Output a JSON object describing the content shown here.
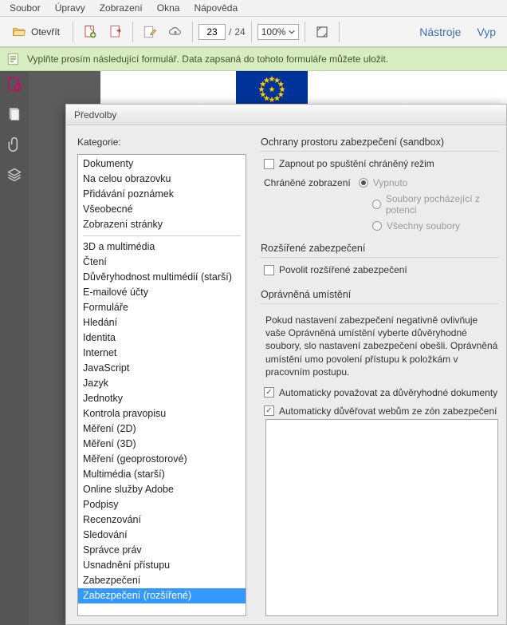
{
  "menubar": [
    "Soubor",
    "Úpravy",
    "Zobrazení",
    "Okna",
    "Nápověda"
  ],
  "toolbar": {
    "open_label": "Otevřít",
    "page_current": "23",
    "page_total": "24",
    "page_sep": "/",
    "zoom": "100%",
    "tools_label": "Nástroje",
    "fill_label": "Vyp"
  },
  "infobar": {
    "text": "Vyplňte prosím následující formulář. Data zapsaná do tohoto formuláře můžete uložit."
  },
  "dialog": {
    "title": "Předvolby",
    "categories_label": "Kategorie:",
    "categories_top": [
      "Dokumenty",
      "Na celou obrazovku",
      "Přidávání poznámek",
      "Všeobecné",
      "Zobrazení stránky"
    ],
    "categories": [
      "3D a multimédia",
      "Čtení",
      "Důvěryhodnost multimédií (starší)",
      "E-mailové účty",
      "Formuláře",
      "Hledání",
      "Identita",
      "Internet",
      "JavaScript",
      "Jazyk",
      "Jednotky",
      "Kontrola pravopisu",
      "Měření (2D)",
      "Měření (3D)",
      "Měření (geoprostorové)",
      "Multimédia (starší)",
      "Online služby Adobe",
      "Podpisy",
      "Recenzování",
      "Sledování",
      "Správce práv",
      "Usnadnění přístupu",
      "Zabezpečení",
      "Zabezpečení (rozšířené)"
    ],
    "selected_category": "Zabezpečení (rozšířené)",
    "sandbox": {
      "title": "Ochrany prostoru zabezpečení (sandbox)",
      "protected_mode": "Zapnout po spuštění chráněný režim",
      "protected_view_label": "Chráněné zobrazení",
      "opt_off": "Vypnuto",
      "opt_files": "Soubory pocházející z potenci",
      "opt_all": "Všechny soubory"
    },
    "enhanced": {
      "title": "Rozšířené zabezpečení",
      "enable": "Povolit rozšířené zabezpečení"
    },
    "locations": {
      "title": "Oprávněná umístění",
      "desc": "Pokud nastavení zabezpečení negativně ovlivňuje vaše Oprávněná umístění vyberte důvěryhodné soubory, slo nastavení zabezpečení obešli. Oprávněná umístění umo povolení přístupu k položkám v pracovním postupu.",
      "auto_docs": "Automaticky považovat za důvěryhodné dokumenty",
      "auto_sites": "Automaticky důvěřovat webům ze zón zabezpečení"
    }
  }
}
